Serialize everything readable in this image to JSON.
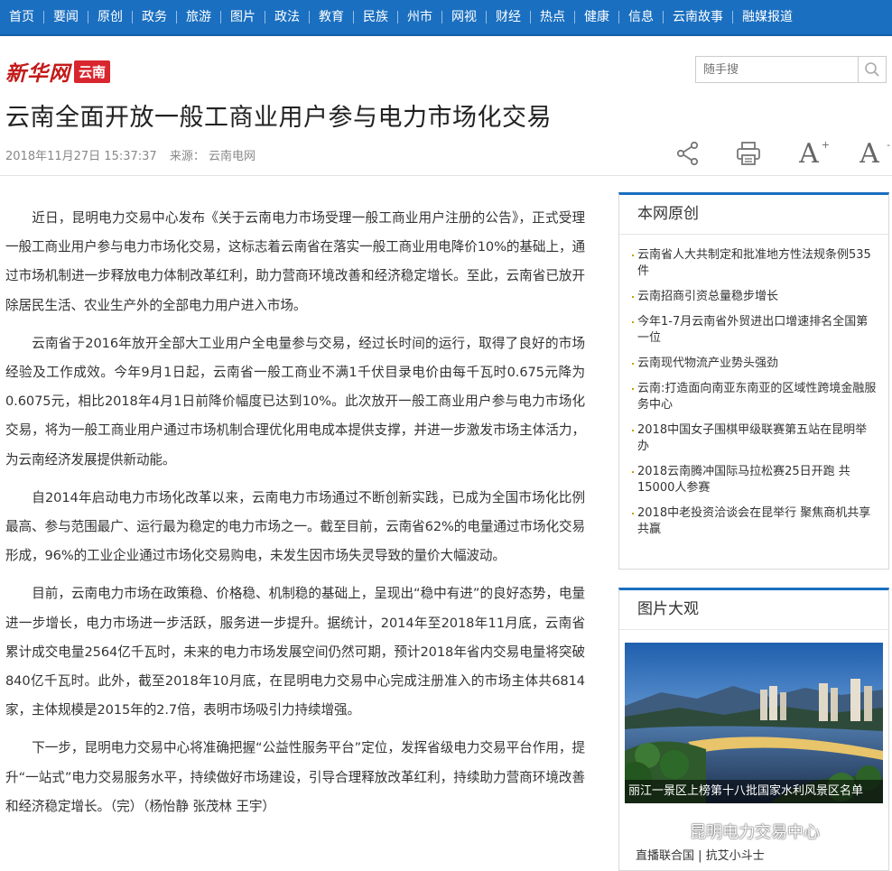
{
  "nav": [
    "首页",
    "要闻",
    "原创",
    "政务",
    "旅游",
    "图片",
    "政法",
    "教育",
    "民族",
    "州市",
    "网视",
    "财经",
    "热点",
    "健康",
    "信息",
    "云南故事",
    "融媒报道"
  ],
  "logo": {
    "main": "新华网",
    "sub": "云南"
  },
  "search": {
    "placeholder": "随手搜"
  },
  "article": {
    "title": "云南全面开放一般工商业用户参与电力市场化交易",
    "date": "2018年11月27日 15:37:37",
    "source": "来源： 云南电网",
    "paragraphs": [
      "近日，昆明电力交易中心发布《关于云南电力市场受理一般工商业用户注册的公告》，正式受理一般工商业用户参与电力市场化交易，这标志着云南省在落实一般工商业用电降价10%的基础上，通过市场机制进一步释放电力体制改革红利，助力营商环境改善和经济稳定增长。至此，云南省已放开除居民生活、农业生产外的全部电力用户进入市场。",
      "云南省于2016年放开全部大工业用户全电量参与交易，经过长时间的运行，取得了良好的市场经验及工作成效。今年9月1日起，云南省一般工商业不满1千伏目录电价由每千瓦时0.675元降为0.6075元，相比2018年4月1日前降价幅度已达到10%。此次放开一般工商业用户参与电力市场化交易，将为一般工商业用户通过市场机制合理优化用电成本提供支撑，并进一步激发市场主体活力，为云南经济发展提供新动能。",
      "自2014年启动电力市场化改革以来，云南电力市场通过不断创新实践，已成为全国市场化比例最高、参与范围最广、运行最为稳定的电力市场之一。截至目前，云南省62%的电量通过市场化交易形成，96%的工业企业通过市场化交易购电，未发生因市场失灵导致的量价大幅波动。",
      "目前，云南电力市场在政策稳、价格稳、机制稳的基础上，呈现出“稳中有进”的良好态势，电量进一步增长，电力市场进一步活跃，服务进一步提升。据统计，2014年至2018年11月底，云南省累计成交电量2564亿千瓦时，未来的电力市场发展空间仍然可期，预计2018年省内交易电量将突破840亿千瓦时。此外，截至2018年10月底，在昆明电力交易中心完成注册准入的市场主体共6814家，主体规模是2015年的2.7倍，表明市场吸引力持续增强。",
      "下一步，昆明电力交易中心将准确把握“公益性服务平台”定位，发挥省级电力交易平台作用，提升“一站式”电力交易服务水平，持续做好市场建设，引导合理释放改革红利，持续助力营商环境改善和经济稳定增长。（完）（杨怡静 张茂林 王宇）"
    ]
  },
  "sidebar": {
    "original": {
      "heading": "本网原创",
      "items": [
        "云南省人大共制定和批准地方性法规条例535件",
        "云南招商引资总量稳步增长",
        "今年1-7月云南省外贸进出口增速排名全国第一位",
        "云南现代物流产业势头强劲",
        "云南:打造面向南亚东南亚的区域性跨境金融服务中心",
        "2018中国女子围棋甲级联赛第五站在昆明举办",
        "2018云南腾冲国际马拉松赛25日开跑 共15000人参赛",
        "2018中老投资洽谈会在昆举行 聚焦商机共享共赢"
      ]
    },
    "photos": {
      "heading": "图片大观",
      "caption": "丽江一景区上榜第十八批国家水利风景区名单",
      "link": "直播联合国 | 抗艾小斗士"
    }
  },
  "watermark": "昆明电力交易中心",
  "colors": {
    "nav_bg": "#1a6fc0",
    "brand_red": "#d8262e",
    "bullet": "#c8a000"
  },
  "icons": [
    "search-icon",
    "share-icon",
    "print-icon",
    "font-increase-icon",
    "font-decrease-icon",
    "wechat-icon"
  ]
}
